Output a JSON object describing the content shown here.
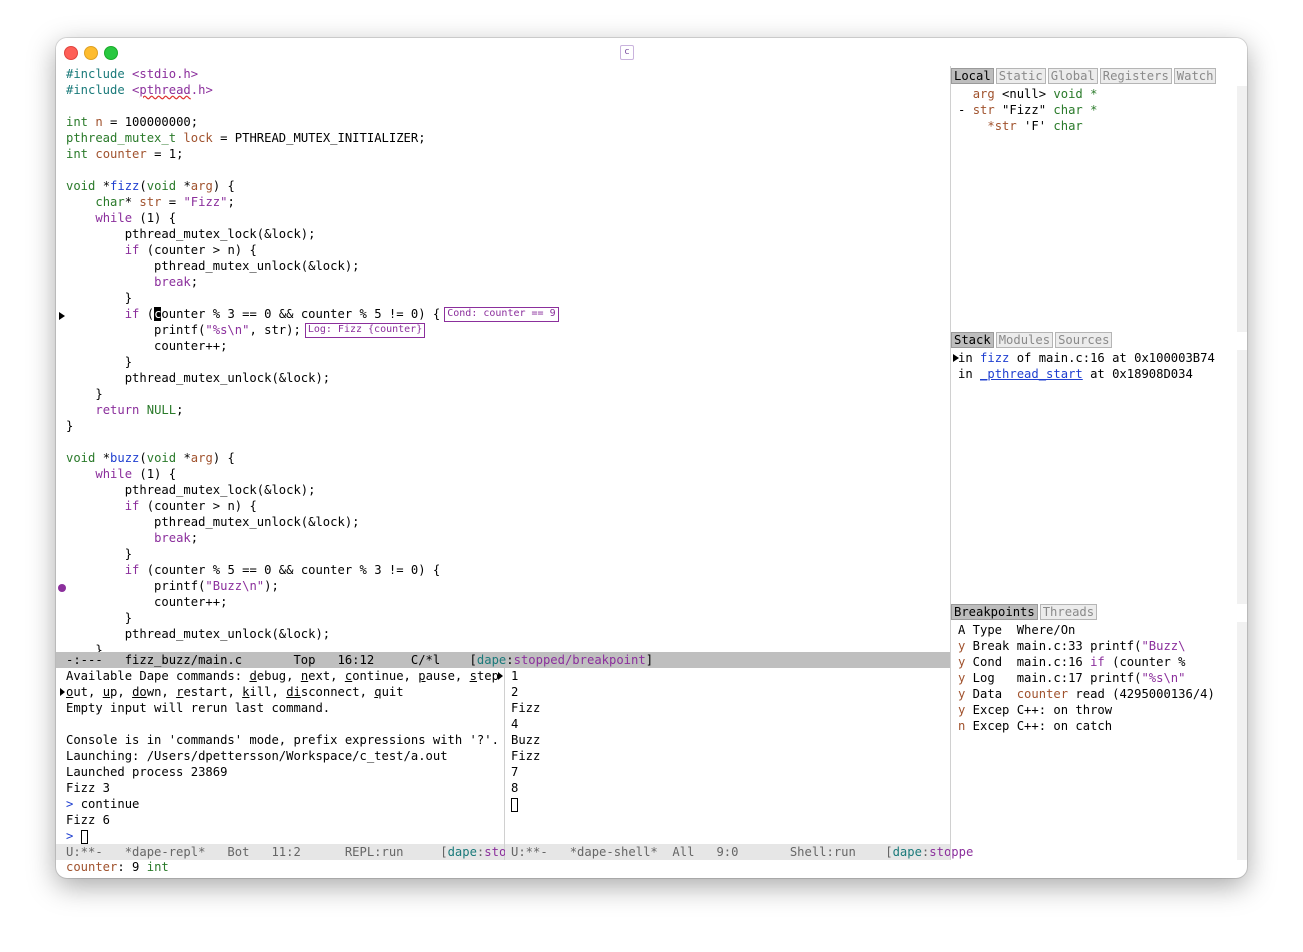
{
  "window": {
    "title_icon": "c"
  },
  "editor": {
    "lines": [
      [
        {
          "t": "#include ",
          "c": "inc"
        },
        {
          "t": "<stdio.h>",
          "c": "st"
        }
      ],
      [
        {
          "t": "#include ",
          "c": "inc"
        },
        {
          "t": "<",
          "c": "st"
        },
        {
          "t": "pthread",
          "c": "st u"
        },
        {
          "t": ".h>",
          "c": "st"
        }
      ],
      [],
      [
        {
          "t": "int",
          "c": "ty"
        },
        {
          "t": " "
        },
        {
          "t": "n",
          "c": "va"
        },
        {
          "t": " = 100000000;"
        }
      ],
      [
        {
          "t": "pthread_mutex_t",
          "c": "ty"
        },
        {
          "t": " "
        },
        {
          "t": "lock",
          "c": "va"
        },
        {
          "t": " = PTHREAD_MUTEX_INITIALIZER;"
        }
      ],
      [
        {
          "t": "int",
          "c": "ty"
        },
        {
          "t": " "
        },
        {
          "t": "counter",
          "c": "va"
        },
        {
          "t": " = 1;"
        }
      ],
      [],
      [
        {
          "t": "void",
          "c": "ty"
        },
        {
          "t": " *"
        },
        {
          "t": "fizz",
          "c": "fn"
        },
        {
          "t": "("
        },
        {
          "t": "void",
          "c": "ty"
        },
        {
          "t": " *"
        },
        {
          "t": "arg",
          "c": "va"
        },
        {
          "t": ") {"
        }
      ],
      [
        {
          "t": "    "
        },
        {
          "t": "char",
          "c": "ty"
        },
        {
          "t": "* "
        },
        {
          "t": "str",
          "c": "va"
        },
        {
          "t": " = "
        },
        {
          "t": "\"Fizz\"",
          "c": "st"
        },
        {
          "t": ";"
        }
      ],
      [
        {
          "t": "    "
        },
        {
          "t": "while",
          "c": "kw"
        },
        {
          "t": " (1) {"
        }
      ],
      [
        {
          "t": "        pthread_mutex_lock(&lock);"
        }
      ],
      [
        {
          "t": "        "
        },
        {
          "t": "if",
          "c": "kw"
        },
        {
          "t": " (counter > n) {"
        }
      ],
      [
        {
          "t": "            pthread_mutex_unlock(&lock);"
        }
      ],
      [
        {
          "t": "            "
        },
        {
          "t": "break",
          "c": "kw"
        },
        {
          "t": ";"
        }
      ],
      [
        {
          "t": "        }"
        }
      ],
      [
        {
          "t": "        "
        },
        {
          "t": "if",
          "c": "kw"
        },
        {
          "t": " ("
        },
        {
          "t": "c",
          "c": "curchar"
        },
        {
          "t": "ounter % 3 == 0 && counter % 5 != 0) {"
        },
        {
          "ovl": "Cond: counter == 9"
        }
      ],
      [
        {
          "t": "            printf("
        },
        {
          "t": "\"%s\\n\"",
          "c": "st"
        },
        {
          "t": ", str);"
        },
        {
          "ovl": "Log: Fizz {counter}"
        }
      ],
      [
        {
          "t": "            counter++;"
        }
      ],
      [
        {
          "t": "        }"
        }
      ],
      [
        {
          "t": "        pthread_mutex_unlock(&lock);"
        }
      ],
      [
        {
          "t": "    }"
        }
      ],
      [
        {
          "t": "    "
        },
        {
          "t": "return",
          "c": "kw"
        },
        {
          "t": " "
        },
        {
          "t": "NULL",
          "c": "co"
        },
        {
          "t": ";"
        }
      ],
      [
        {
          "t": "}"
        }
      ],
      [],
      [
        {
          "t": "void",
          "c": "ty"
        },
        {
          "t": " *"
        },
        {
          "t": "buzz",
          "c": "fn"
        },
        {
          "t": "("
        },
        {
          "t": "void",
          "c": "ty"
        },
        {
          "t": " *"
        },
        {
          "t": "arg",
          "c": "va"
        },
        {
          "t": ") {"
        }
      ],
      [
        {
          "t": "    "
        },
        {
          "t": "while",
          "c": "kw"
        },
        {
          "t": " (1) {"
        }
      ],
      [
        {
          "t": "        pthread_mutex_lock(&lock);"
        }
      ],
      [
        {
          "t": "        "
        },
        {
          "t": "if",
          "c": "kw"
        },
        {
          "t": " (counter > n) {"
        }
      ],
      [
        {
          "t": "            pthread_mutex_unlock(&lock);"
        }
      ],
      [
        {
          "t": "            "
        },
        {
          "t": "break",
          "c": "kw"
        },
        {
          "t": ";"
        }
      ],
      [
        {
          "t": "        }"
        }
      ],
      [
        {
          "t": "        "
        },
        {
          "t": "if",
          "c": "kw"
        },
        {
          "t": " (counter % 5 == 0 && counter % 3 != 0) {"
        }
      ],
      [
        {
          "t": "            printf("
        },
        {
          "t": "\"Buzz\\n\"",
          "c": "st"
        },
        {
          "t": ");"
        }
      ],
      [
        {
          "t": "            counter++;"
        }
      ],
      [
        {
          "t": "        }"
        }
      ],
      [
        {
          "t": "        pthread_mutex_unlock(&lock);"
        }
      ],
      [
        {
          "t": "    }"
        }
      ]
    ],
    "modeline": [
      {
        "t": "-:---   fizz_buzz/main.c       Top   16:12     C/*l    ["
      },
      {
        "t": "dape",
        "c": "teal"
      },
      {
        "t": ":"
      },
      {
        "t": "stopped/breakpoint",
        "c": "purple"
      },
      {
        "t": "]"
      }
    ]
  },
  "repl": {
    "lines": [
      [
        {
          "t": "Available Dape commands: "
        },
        {
          "t": "d",
          "c": "und"
        },
        {
          "t": "ebug, "
        },
        {
          "t": "n",
          "c": "und"
        },
        {
          "t": "ext, "
        },
        {
          "t": "c",
          "c": "und"
        },
        {
          "t": "ontinue, "
        },
        {
          "t": "p",
          "c": "und"
        },
        {
          "t": "ause, "
        },
        {
          "t": "s",
          "c": "und"
        },
        {
          "t": "tep,"
        }
      ],
      [
        {
          "t": "o",
          "c": "und"
        },
        {
          "t": "ut, "
        },
        {
          "t": "u",
          "c": "und"
        },
        {
          "t": "p, "
        },
        {
          "t": "do",
          "c": "und"
        },
        {
          "t": "wn, "
        },
        {
          "t": "r",
          "c": "und"
        },
        {
          "t": "estart, "
        },
        {
          "t": "k",
          "c": "und"
        },
        {
          "t": "ill, "
        },
        {
          "t": "di",
          "c": "und"
        },
        {
          "t": "sconnect, "
        },
        {
          "t": "q",
          "c": "und"
        },
        {
          "t": "uit"
        }
      ],
      [
        {
          "t": "Empty input will rerun last command."
        }
      ],
      [],
      [
        {
          "t": "Console is in 'commands' mode, prefix expressions with '?'."
        }
      ],
      [
        {
          "t": "Launching: /Users/dpettersson/Workspace/c_test/a.out"
        }
      ],
      [
        {
          "t": "Launched process 23869"
        }
      ],
      [
        {
          "t": "Fizz 3"
        }
      ],
      [
        {
          "t": "> ",
          "c": "blue"
        },
        {
          "t": "continue"
        }
      ],
      [
        {
          "t": "Fizz 6"
        }
      ],
      [
        {
          "t": "> ",
          "c": "blue"
        },
        {
          "cursor": true
        }
      ]
    ],
    "modeline": [
      {
        "t": "U:**-   *dape-repl*   Bot   11:2      REPL:run     ["
      },
      {
        "t": "dape",
        "c": "teal"
      },
      {
        "t": ":"
      },
      {
        "t": "stopped",
        "c": "purple"
      }
    ]
  },
  "shell": {
    "lines": [
      [
        {
          "t": "1"
        }
      ],
      [
        {
          "t": "2"
        }
      ],
      [
        {
          "t": "Fizz"
        }
      ],
      [
        {
          "t": "4"
        }
      ],
      [
        {
          "t": "Buzz"
        }
      ],
      [
        {
          "t": "Fizz"
        }
      ],
      [
        {
          "t": "7"
        }
      ],
      [
        {
          "t": "8"
        }
      ],
      [
        {
          "cursor": true
        }
      ]
    ],
    "modeline": [
      {
        "t": "U:**-   *dape-shell*  All   9:0       Shell:run    ["
      },
      {
        "t": "dape",
        "c": "teal"
      },
      {
        "t": ":"
      },
      {
        "t": "stoppe",
        "c": "purple"
      }
    ]
  },
  "scopes": {
    "tabs": [
      "Local",
      "Static",
      "Global",
      "Registers",
      "Watch"
    ],
    "active_tab": "Local",
    "lines": [
      [
        {
          "t": "  "
        },
        {
          "t": "arg",
          "c": "brown"
        },
        {
          "t": " <null> "
        },
        {
          "t": "void *",
          "c": "green"
        }
      ],
      [
        {
          "t": "- "
        },
        {
          "t": "str",
          "c": "brown"
        },
        {
          "t": " \"Fizz\" "
        },
        {
          "t": "char *",
          "c": "green"
        }
      ],
      [
        {
          "t": "    "
        },
        {
          "t": "*str",
          "c": "brown"
        },
        {
          "t": " 'F' "
        },
        {
          "t": "char",
          "c": "green"
        }
      ]
    ]
  },
  "stack": {
    "tabs": [
      "Stack",
      "Modules",
      "Sources"
    ],
    "active_tab": "Stack",
    "lines": [
      [
        {
          "t": "in "
        },
        {
          "t": "fizz",
          "c": "blue"
        },
        {
          "t": " of main.c:16 at 0x100003B74"
        }
      ],
      [
        {
          "t": "in "
        },
        {
          "t": "_pthread_start",
          "c": "blue und"
        },
        {
          "t": " at 0x18908D034"
        }
      ]
    ]
  },
  "breakpoints": {
    "tabs": [
      "Breakpoints",
      "Threads"
    ],
    "active_tab": "Breakpoints",
    "lines": [
      [
        {
          "t": "A Type  Where/On"
        }
      ],
      [
        {
          "t": "y",
          "c": "brown"
        },
        {
          "t": " Break main.c:33 printf("
        },
        {
          "t": "\"Buzz\\",
          "c": "purple"
        }
      ],
      [
        {
          "t": "y",
          "c": "brown"
        },
        {
          "t": " Cond  main.c:16 "
        },
        {
          "t": "if",
          "c": "purple"
        },
        {
          "t": " (counter %"
        }
      ],
      [
        {
          "t": "y",
          "c": "brown"
        },
        {
          "t": " Log   main.c:17 printf("
        },
        {
          "t": "\"%s\\n\"",
          "c": "purple"
        }
      ],
      [
        {
          "t": "y",
          "c": "brown"
        },
        {
          "t": " Data  "
        },
        {
          "t": "counter",
          "c": "brown"
        },
        {
          "t": " read (4295000136/4)"
        }
      ],
      [
        {
          "t": "y",
          "c": "brown"
        },
        {
          "t": " Excep C++: on throw"
        }
      ],
      [
        {
          "t": "n",
          "c": "brown"
        },
        {
          "t": " Excep C++: on catch"
        }
      ]
    ]
  },
  "echo_area": [
    {
      "t": "counter",
      "c": "brown"
    },
    {
      "t": ": 9 "
    },
    {
      "t": "int",
      "c": "green"
    }
  ]
}
